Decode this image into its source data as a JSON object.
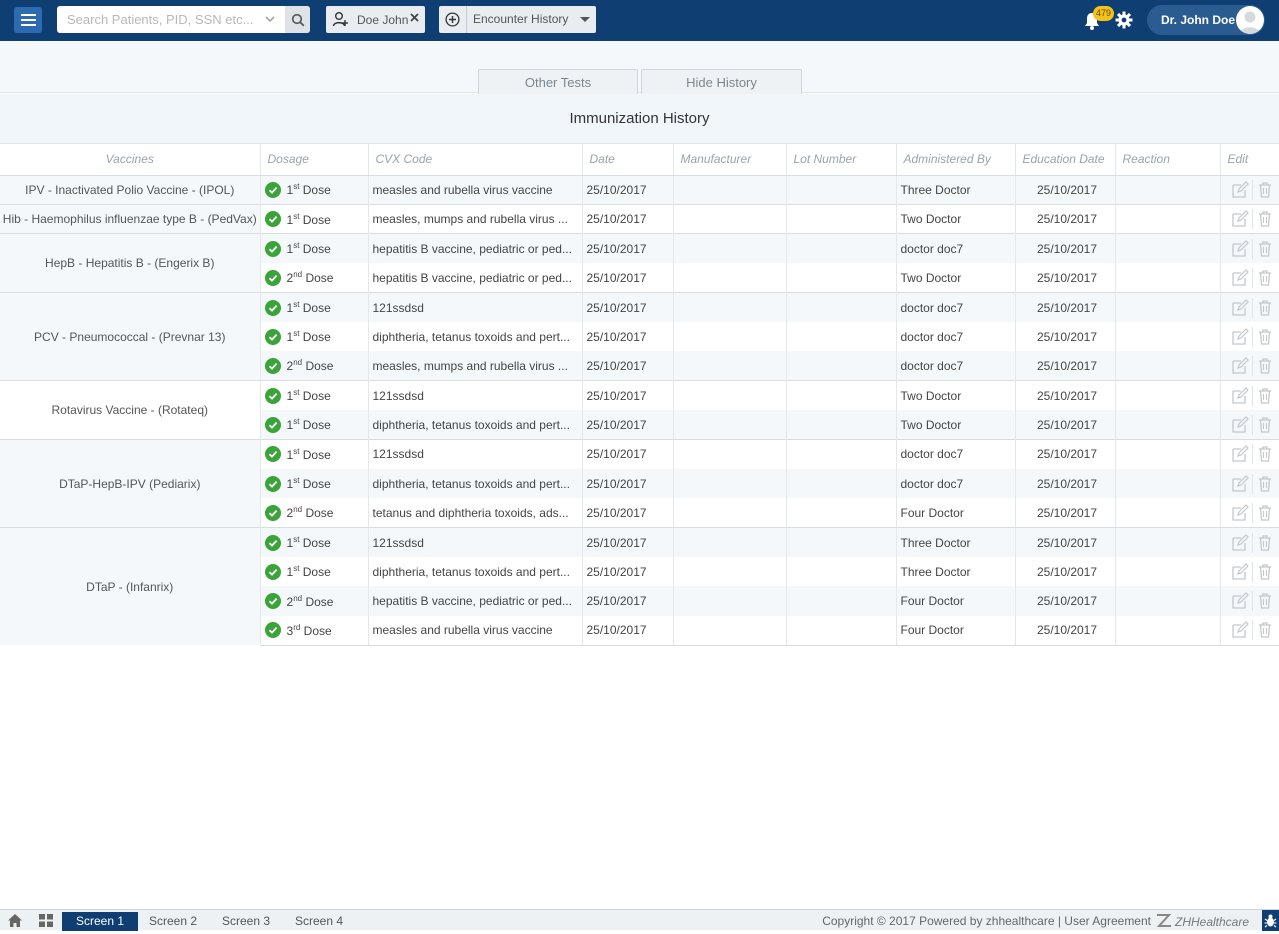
{
  "header": {
    "search_placeholder": "Search Patients, PID, SSN etc...",
    "patient_chip": "Doe John",
    "encounter_label": "Encounter History",
    "notification_count": "479",
    "user_name": "Dr. John Doe"
  },
  "tabs": [
    "Other Tests",
    "Hide History"
  ],
  "panel_title": "Immunization History",
  "columns": [
    "Vaccines",
    "Dosage",
    "CVX Code",
    "Date",
    "Manufacturer",
    "Lot Number",
    "Administered By",
    "Education Date",
    "Reaction",
    "Edit"
  ],
  "rows": [
    {
      "vaccine": "IPV - Inactivated Polio Vaccine - (IPOL)",
      "span": 1,
      "dose_num": "1",
      "dose_sup": "st",
      "dose_word": "Dose",
      "cvx": "measles and rubella virus vaccine",
      "date": "25/10/2017",
      "manufacturer": "",
      "lot": "",
      "admin": "Three Doctor",
      "edu_date": "25/10/2017",
      "reaction": ""
    },
    {
      "vaccine": "Hib - Haemophilus influenzae type B - (PedVax)",
      "span": 1,
      "dose_num": "1",
      "dose_sup": "st",
      "dose_word": "Dose",
      "cvx": "measles, mumps and rubella virus ...",
      "date": "25/10/2017",
      "manufacturer": "",
      "lot": "",
      "admin": "Two Doctor",
      "edu_date": "25/10/2017",
      "reaction": ""
    },
    {
      "vaccine": "HepB - Hepatitis B - (Engerix B)",
      "span": 2,
      "dose_num": "1",
      "dose_sup": "st",
      "dose_word": "Dose",
      "cvx": "hepatitis B vaccine, pediatric or ped...",
      "date": "25/10/2017",
      "manufacturer": "",
      "lot": "",
      "admin": "doctor doc7",
      "edu_date": "25/10/2017",
      "reaction": ""
    },
    {
      "vaccine": "",
      "span": 0,
      "dose_num": "2",
      "dose_sup": "nd",
      "dose_word": "Dose",
      "cvx": "hepatitis B vaccine, pediatric or ped...",
      "date": "25/10/2017",
      "manufacturer": "",
      "lot": "",
      "admin": "Two Doctor",
      "edu_date": "25/10/2017",
      "reaction": ""
    },
    {
      "vaccine": "PCV - Pneumococcal - (Prevnar 13)",
      "span": 3,
      "dose_num": "1",
      "dose_sup": "st",
      "dose_word": "Dose",
      "cvx": "121ssdsd",
      "date": "25/10/2017",
      "manufacturer": "",
      "lot": "",
      "admin": "doctor doc7",
      "edu_date": "25/10/2017",
      "reaction": ""
    },
    {
      "vaccine": "",
      "span": 0,
      "dose_num": "1",
      "dose_sup": "st",
      "dose_word": "Dose",
      "cvx": "diphtheria, tetanus toxoids and pert...",
      "date": "25/10/2017",
      "manufacturer": "",
      "lot": "",
      "admin": "doctor doc7",
      "edu_date": "25/10/2017",
      "reaction": ""
    },
    {
      "vaccine": "",
      "span": 0,
      "dose_num": "2",
      "dose_sup": "nd",
      "dose_word": "Dose",
      "cvx": "measles, mumps and rubella virus ...",
      "date": "25/10/2017",
      "manufacturer": "",
      "lot": "",
      "admin": "doctor doc7",
      "edu_date": "25/10/2017",
      "reaction": ""
    },
    {
      "vaccine": "Rotavirus Vaccine - (Rotateq)",
      "span": 2,
      "dose_num": "1",
      "dose_sup": "st",
      "dose_word": "Dose",
      "cvx": "121ssdsd",
      "date": "25/10/2017",
      "manufacturer": "",
      "lot": "",
      "admin": "Two Doctor",
      "edu_date": "25/10/2017",
      "reaction": ""
    },
    {
      "vaccine": "",
      "span": 0,
      "dose_num": "1",
      "dose_sup": "st",
      "dose_word": "Dose",
      "cvx": "diphtheria, tetanus toxoids and pert...",
      "date": "25/10/2017",
      "manufacturer": "",
      "lot": "",
      "admin": "Two Doctor",
      "edu_date": "25/10/2017",
      "reaction": ""
    },
    {
      "vaccine": "DTaP-HepB-IPV (Pediarix)",
      "span": 3,
      "dose_num": "1",
      "dose_sup": "st",
      "dose_word": "Dose",
      "cvx": "121ssdsd",
      "date": "25/10/2017",
      "manufacturer": "",
      "lot": "",
      "admin": "doctor doc7",
      "edu_date": "25/10/2017",
      "reaction": ""
    },
    {
      "vaccine": "",
      "span": 0,
      "dose_num": "1",
      "dose_sup": "st",
      "dose_word": "Dose",
      "cvx": "diphtheria, tetanus toxoids and pert...",
      "date": "25/10/2017",
      "manufacturer": "",
      "lot": "",
      "admin": "doctor doc7",
      "edu_date": "25/10/2017",
      "reaction": ""
    },
    {
      "vaccine": "",
      "span": 0,
      "dose_num": "2",
      "dose_sup": "nd",
      "dose_word": "Dose",
      "cvx": "tetanus and diphtheria toxoids, ads...",
      "date": "25/10/2017",
      "manufacturer": "",
      "lot": "",
      "admin": "Four Doctor",
      "edu_date": "25/10/2017",
      "reaction": ""
    },
    {
      "vaccine": "DTaP - (Infanrix)",
      "span": 4,
      "dose_num": "1",
      "dose_sup": "st",
      "dose_word": "Dose",
      "cvx": "121ssdsd",
      "date": "25/10/2017",
      "manufacturer": "",
      "lot": "",
      "admin": "Three Doctor",
      "edu_date": "25/10/2017",
      "reaction": ""
    },
    {
      "vaccine": "",
      "span": 0,
      "dose_num": "1",
      "dose_sup": "st",
      "dose_word": "Dose",
      "cvx": "diphtheria, tetanus toxoids and pert...",
      "date": "25/10/2017",
      "manufacturer": "",
      "lot": "",
      "admin": "Three Doctor",
      "edu_date": "25/10/2017",
      "reaction": ""
    },
    {
      "vaccine": "",
      "span": 0,
      "dose_num": "2",
      "dose_sup": "nd",
      "dose_word": "Dose",
      "cvx": "hepatitis B vaccine, pediatric or ped...",
      "date": "25/10/2017",
      "manufacturer": "",
      "lot": "",
      "admin": "Four Doctor",
      "edu_date": "25/10/2017",
      "reaction": ""
    },
    {
      "vaccine": "",
      "span": 0,
      "dose_num": "3",
      "dose_sup": "rd",
      "dose_word": "Dose",
      "cvx": "measles and rubella virus vaccine",
      "date": "25/10/2017",
      "manufacturer": "",
      "lot": "",
      "admin": "Four Doctor",
      "edu_date": "25/10/2017",
      "reaction": ""
    }
  ],
  "footer": {
    "tabs": [
      "Screen 1",
      "Screen 2",
      "Screen 3",
      "Screen 4"
    ],
    "active_tab": "Screen 1",
    "copyright": "Copyright © 2017 Powered by zhhealthcare | User Agreement",
    "brand": "ZHHealthcare"
  },
  "icons": [
    "menu-icon",
    "chevron-down-icon",
    "search-icon",
    "add-patient-icon",
    "close-icon",
    "plus-circle-icon",
    "bell-icon",
    "gear-icon",
    "avatar-icon",
    "check-icon",
    "edit-icon",
    "trash-icon",
    "home-icon",
    "grid-icon",
    "bug-icon"
  ],
  "colors": {
    "navy": "#0f3f72",
    "accent_blue": "#2c6bb0",
    "check_green": "#3aa43a",
    "badge_yellow": "#f2c318"
  }
}
